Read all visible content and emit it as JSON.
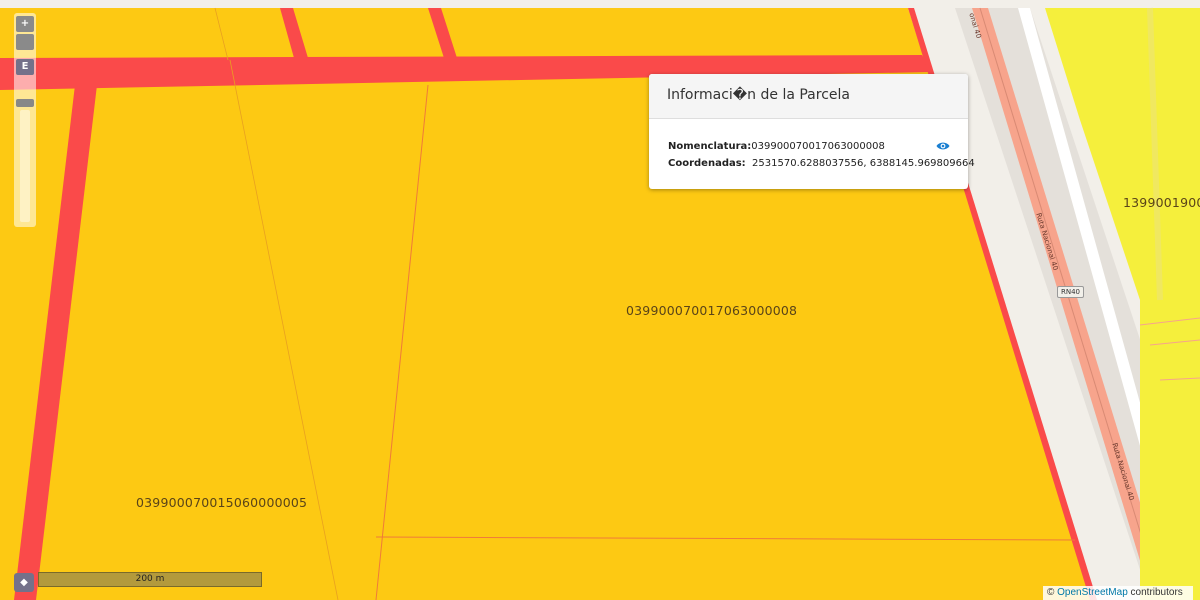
{
  "popup": {
    "title": "Informaci�n de la Parcela",
    "nomenclatura_label": "Nomenclatura:",
    "nomenclatura_value": "039900070017063000008",
    "coordenadas_label": "Coordenadas:",
    "coordenadas_value": "2531570.6288037556, 6388145.969809664"
  },
  "map": {
    "parcel_labels": [
      "039900070017063000008",
      "039900070015060000005",
      "1399001900"
    ],
    "road_labels": {
      "route_name_1": "Ruta Nacional 40",
      "route_name_2": "Ruta Nacional 40",
      "route_top": "onal 40",
      "shield": "RN40"
    },
    "colors": {
      "parcel_fill": "#fdc913",
      "road_red": "#fa4a4a",
      "adjacent_parcel": "#f5ef3c",
      "osm_background": "#f2efe9",
      "highway_orange": "#f7a48c"
    }
  },
  "controls": {
    "zoom_in": "+",
    "extent_button": "E",
    "scale_toggle": "◆",
    "scale_label": "200 m"
  },
  "attribution": {
    "copyright": "©",
    "link": "OpenStreetMap",
    "suffix": " contributors"
  }
}
